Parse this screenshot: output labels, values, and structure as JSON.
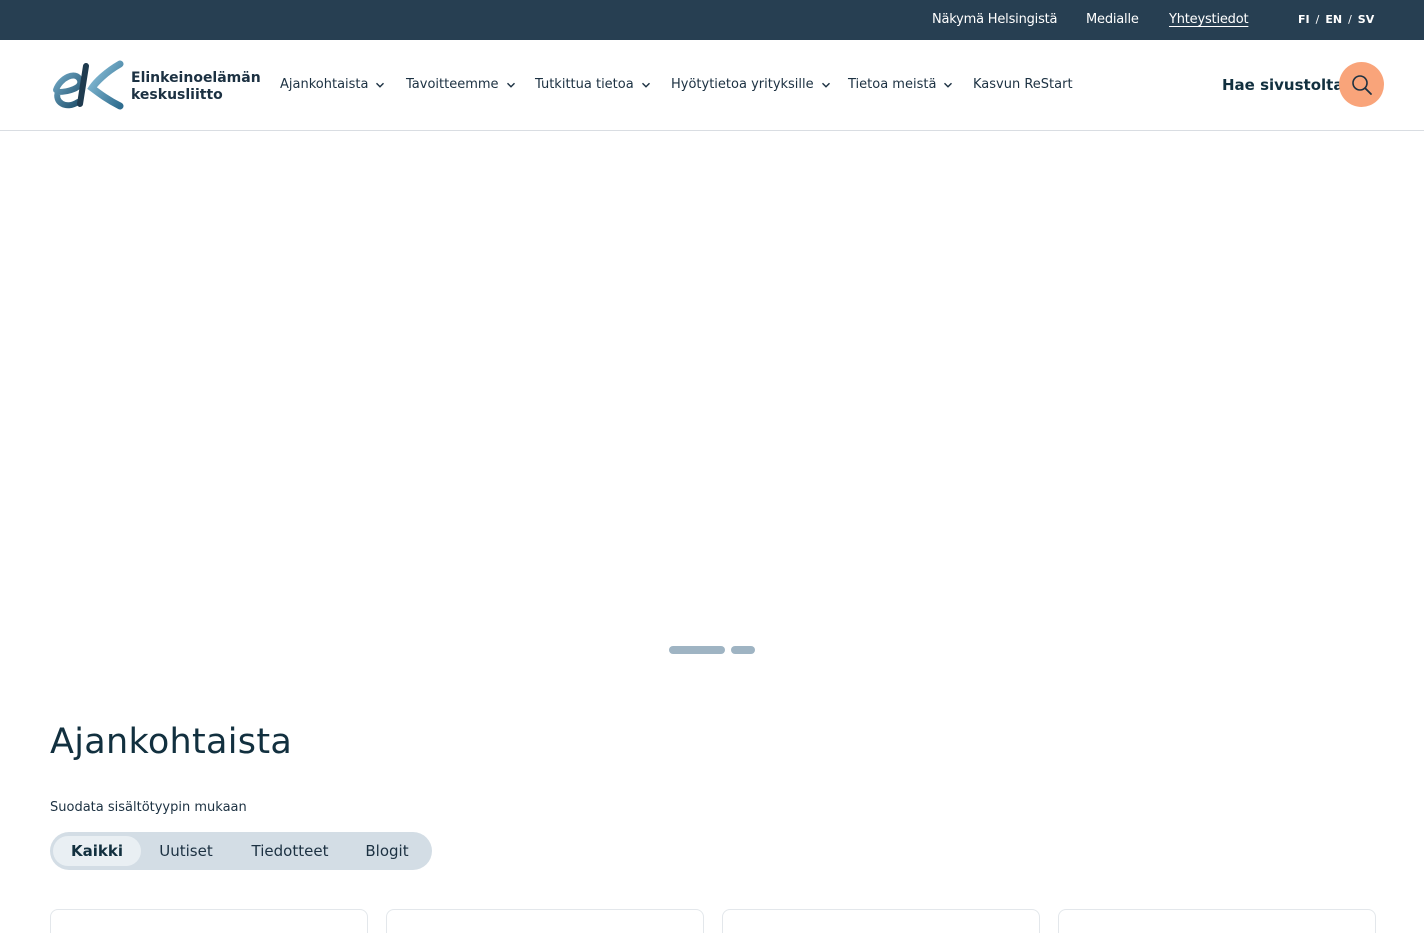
{
  "topbar": {
    "links": [
      "Näkymä Helsingistä",
      "Medialle",
      "Yhteystiedot"
    ],
    "languages": [
      "FI",
      "EN",
      "SV"
    ],
    "lang_separator": "/"
  },
  "header": {
    "logo": {
      "line1": "Elinkeinoelämän",
      "line2": "keskusliitto"
    },
    "nav": [
      {
        "label": "Ajankohtaista",
        "icon": "chevron-down-icon"
      },
      {
        "label": "Tavoitteemme",
        "icon": "chevron-down-icon"
      },
      {
        "label": "Tutkittua tietoa",
        "icon": "chevron-down-icon"
      },
      {
        "label": "Hyötytietoa yrityksille",
        "icon": "chevron-down-icon"
      },
      {
        "label": "Tietoa meistä",
        "icon": "chevron-down-icon"
      },
      {
        "label": "Kasvun ReStart"
      }
    ],
    "search_label": "Hae sivustolta",
    "search_icon": "search-icon"
  },
  "carousel": {
    "slide_count": 2,
    "active_slide": 1
  },
  "section": {
    "title": "Ajankohtaista",
    "filter_label": "Suodata sisältötyypin mukaan",
    "filters": [
      "Kaikki",
      "Uutiset",
      "Tiedotteet",
      "Blogit"
    ],
    "active_filter": "Kaikki"
  },
  "colors": {
    "topbar_bg": "#273f52",
    "accent": "#f9a47a",
    "text_dark": "#12303f",
    "filter_bg": "#d3dde5",
    "dot": "#9fb4c3"
  }
}
